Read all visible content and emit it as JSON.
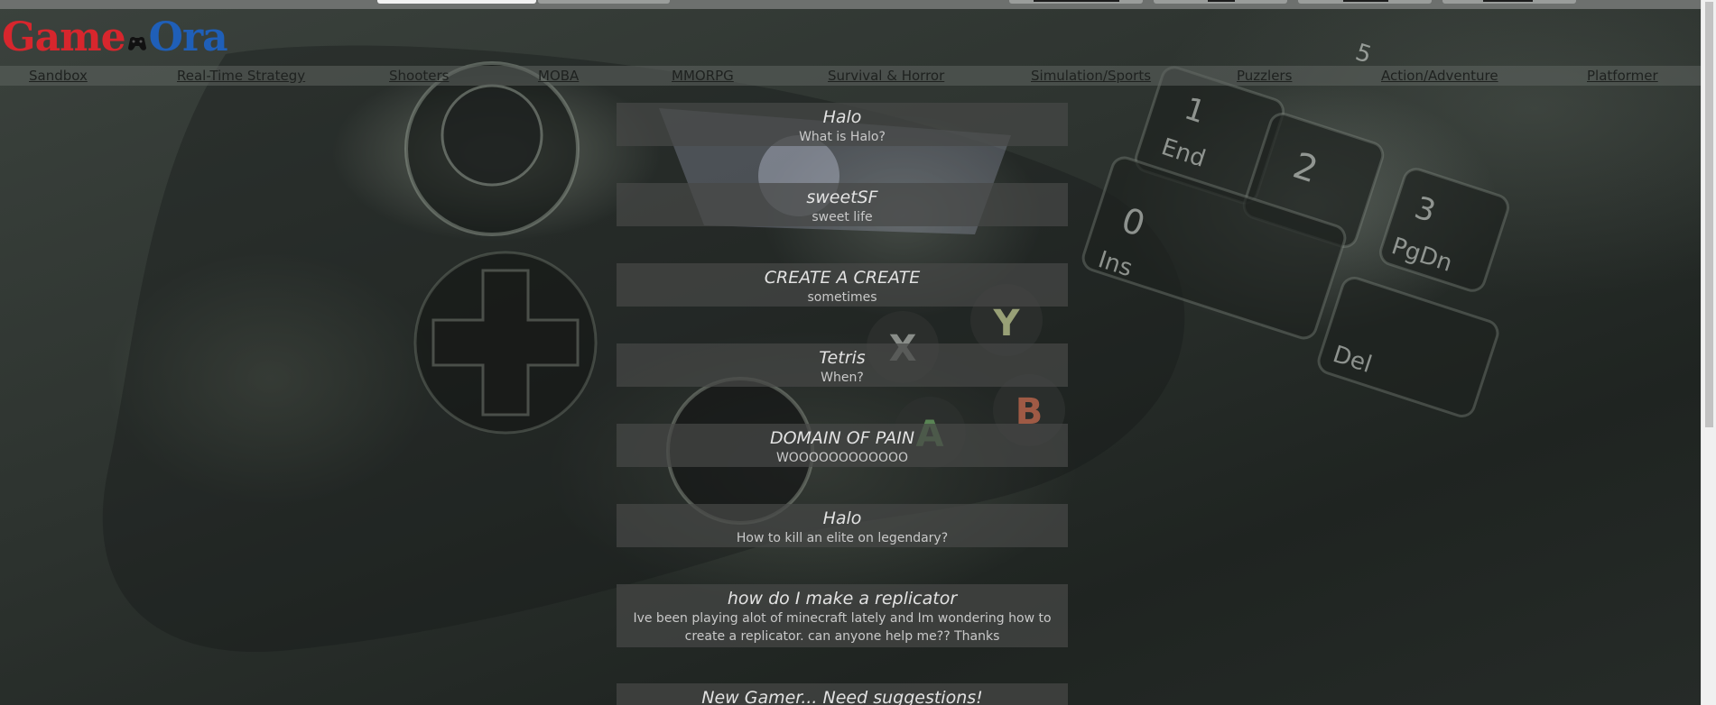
{
  "logo": {
    "part1": "Game",
    "part2": "Ora",
    "icon": "gamepad-icon",
    "colors": {
      "game": "#d7262d",
      "ora": "#1f5fb8"
    }
  },
  "nav": {
    "items": [
      {
        "label": "Sandbox"
      },
      {
        "label": "Real-Time Strategy"
      },
      {
        "label": "Shooters"
      },
      {
        "label": "MOBA"
      },
      {
        "label": "MMORPG"
      },
      {
        "label": "Survival & Horror"
      },
      {
        "label": "Simulation/Sports"
      },
      {
        "label": "Puzzlers"
      },
      {
        "label": "Action/Adventure"
      },
      {
        "label": "Platformer"
      }
    ]
  },
  "posts": [
    {
      "title": "Halo",
      "body": "What is Halo?"
    },
    {
      "title": "sweetSF",
      "body": "sweet life"
    },
    {
      "title": "CREATE A CREATE",
      "body": "sometimes"
    },
    {
      "title": "Tetris",
      "body": "When?"
    },
    {
      "title": "DOMAIN OF PAIN",
      "body": "WOOOOOOOOOOOO"
    },
    {
      "title": "Halo",
      "body": "How to kill an elite on legendary?"
    },
    {
      "title": "how do I make a replicator",
      "body": "Ive been playing alot of minecraft lately and Im wondering how to create a replicator. can anyone help me?? Thanks"
    },
    {
      "title": "New Gamer... Need suggestions!",
      "body": ""
    }
  ],
  "background": {
    "image": "game-controller-and-keyboard-photo",
    "keycaps": [
      "5",
      "1",
      "End",
      "2",
      "0",
      "Ins",
      "3",
      "PgDn",
      "Del"
    ],
    "controller_buttons": [
      "X",
      "Y",
      "A",
      "B"
    ]
  }
}
